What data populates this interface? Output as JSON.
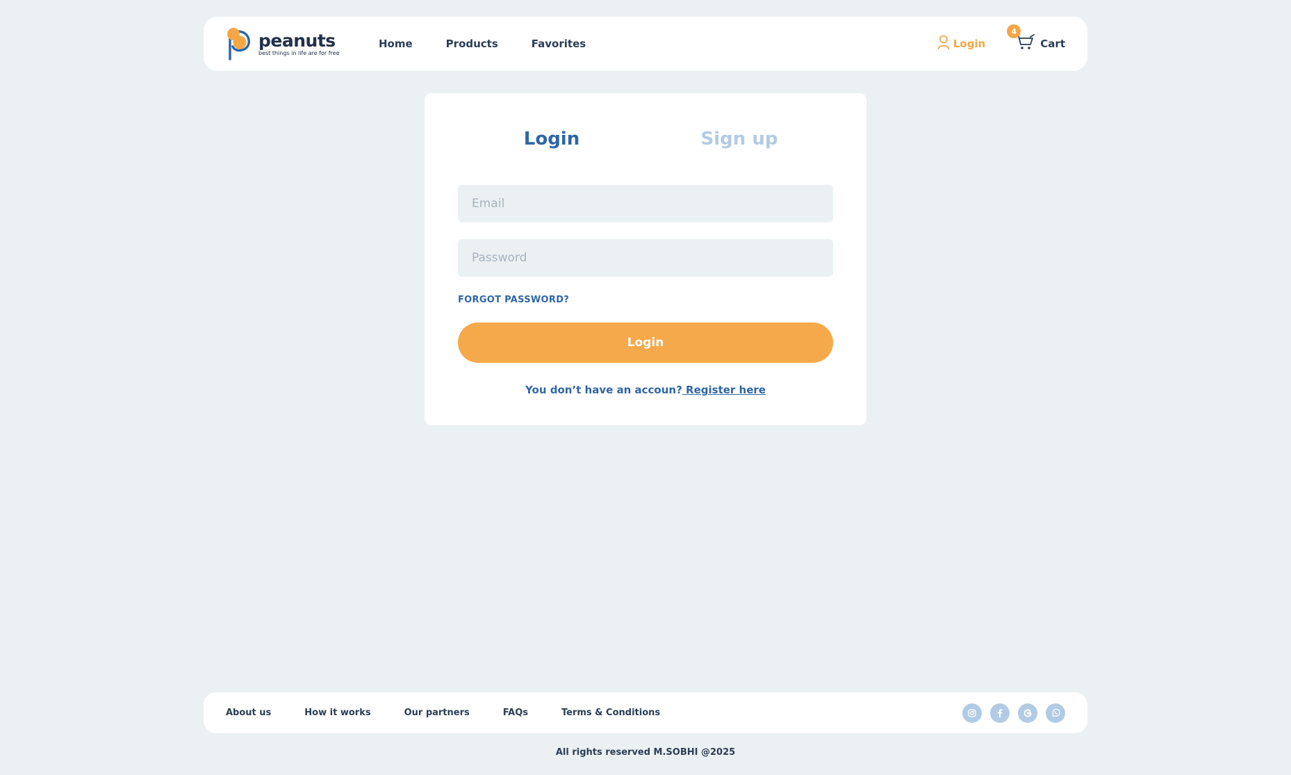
{
  "brand": {
    "name": "peanuts",
    "tagline": "best things in life are for free",
    "colors": {
      "accent": "#f5a745",
      "primary": "#2f66a6",
      "muted": "#b2cbe4",
      "background": "#ebf0f2"
    }
  },
  "header": {
    "nav": [
      "Home",
      "Products",
      "Favorites"
    ],
    "login_label": "Login",
    "cart_label": "Cart",
    "cart_count": "4",
    "icons": {
      "login": "user-icon",
      "cart": "cart-icon"
    }
  },
  "auth": {
    "tabs": {
      "login": "Login",
      "signup": "Sign up",
      "active": "login"
    },
    "email": {
      "placeholder": "Email",
      "value": ""
    },
    "password": {
      "placeholder": "Password",
      "value": ""
    },
    "forgot_label": "FORGOT PASSWORD?",
    "submit_label": "Login",
    "register_prompt": "You don’t have an accoun?",
    "register_link": " Register here"
  },
  "footer": {
    "links": [
      "About us",
      "How it works",
      "Our partners",
      "FAQs",
      "Terms & Conditions"
    ],
    "socials": [
      "instagram-icon",
      "facebook-icon",
      "google-icon",
      "whatsapp-icon"
    ],
    "copyright": "All rights reserved M.SOBHI @2025"
  }
}
